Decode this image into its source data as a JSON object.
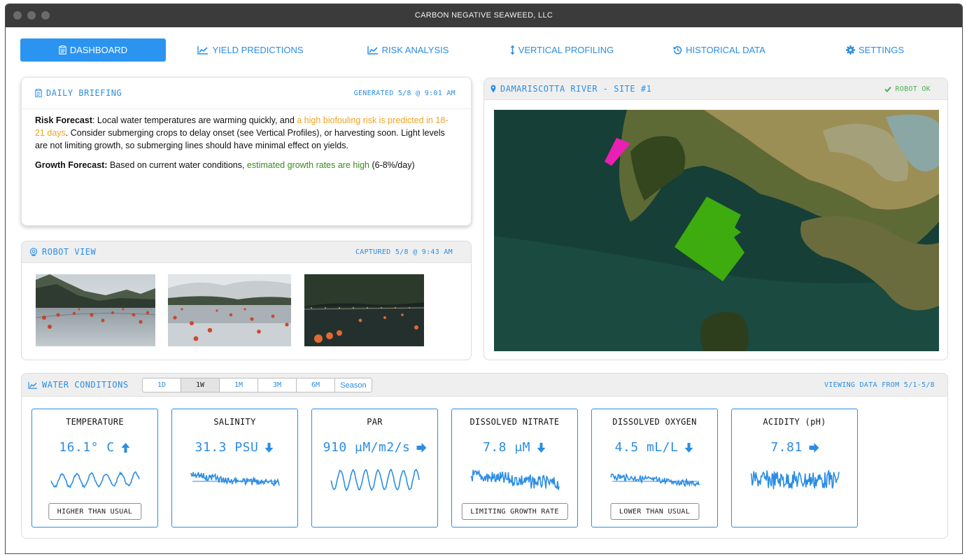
{
  "window": {
    "title": "CARBON NEGATIVE SEAWEED, LLC"
  },
  "nav": {
    "items": [
      {
        "label": "DASHBOARD",
        "icon": "clipboard-icon",
        "active": true
      },
      {
        "label": "YIELD PREDICTIONS",
        "icon": "line-chart-icon"
      },
      {
        "label": "RISK ANALYSIS",
        "icon": "line-chart-icon"
      },
      {
        "label": "VERTICAL PROFILING",
        "icon": "vertical-arrows-icon"
      },
      {
        "label": "HISTORICAL DATA",
        "icon": "history-icon"
      },
      {
        "label": "SETTINGS",
        "icon": "gear-icon"
      }
    ]
  },
  "briefing": {
    "title": "DAILY BRIEFING",
    "generated": "GENERATED 5/8 @ 9:01 AM",
    "risk_label": "Risk Forecast",
    "risk_text_1": ": Local water temperatures are warming quickly, and ",
    "risk_highlight": "a high biofouling risk is predicted in 18-21 days",
    "risk_text_2": ". Consider submerging crops to delay onset (see Vertical Profiles), or harvesting soon. Light levels are not limiting growth, so submerging lines should have minimal effect on yields.",
    "growth_label": "Growth Forecast:",
    "growth_text_1": " Based on current water conditions, ",
    "growth_highlight": "estimated growth rates are high",
    "growth_text_2": " (6-8%/day)"
  },
  "robot_view": {
    "title": "ROBOT VIEW",
    "captured": "CAPTURED 5/8 @ 9:43 AM"
  },
  "site": {
    "title": "DAMARISCOTTA RIVER - SITE #1",
    "status": "ROBOT OK"
  },
  "water": {
    "title": "WATER CONDITIONS",
    "ranges": [
      "1D",
      "1W",
      "1M",
      "3M",
      "6M",
      "Season"
    ],
    "active_range": "1W",
    "viewing": "VIEWING DATA FROM 5/1-5/8",
    "metrics": [
      {
        "title": "TEMPERATURE",
        "value": "16.1° C",
        "trend": "up",
        "badge": "HIGHER THAN USUAL"
      },
      {
        "title": "SALINITY",
        "value": "31.3 PSU",
        "trend": "down",
        "badge": ""
      },
      {
        "title": "PAR",
        "value": "910 μM/m2/s",
        "trend": "right",
        "badge": ""
      },
      {
        "title": "DISSOLVED NITRATE",
        "value": "7.8 μM",
        "trend": "down",
        "badge": "LIMITING GROWTH RATE"
      },
      {
        "title": "DISSOLVED OXYGEN",
        "value": "4.5 mL/L",
        "trend": "down",
        "badge": "LOWER THAN USUAL"
      },
      {
        "title": "ACIDITY (pH)",
        "value": "7.81",
        "trend": "right",
        "badge": ""
      }
    ]
  },
  "colors": {
    "accent": "#2b8de3",
    "active_nav": "#2b94f0",
    "risk": "#f0a321",
    "growth": "#3a8a1f",
    "ok": "#4caf50"
  }
}
